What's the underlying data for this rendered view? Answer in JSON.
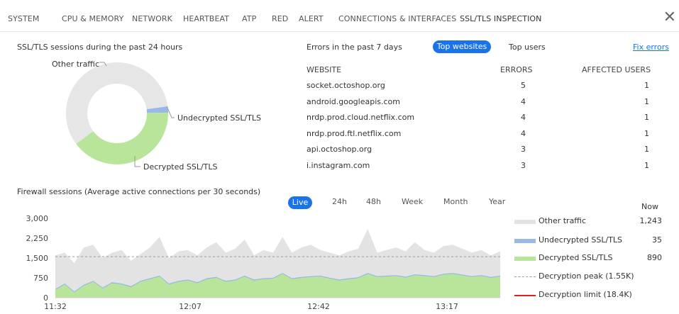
{
  "nav": {
    "tabs": [
      "SYSTEM",
      "CPU & MEMORY",
      "NETWORK",
      "HEARTBEAT",
      "ATP",
      "RED",
      "ALERT",
      "CONNECTIONS & INTERFACES",
      "SSL/TLS INSPECTION"
    ],
    "active_index": 8,
    "close_icon": "close-icon"
  },
  "sessions_donut": {
    "title": "SSL/TLS sessions during the past 24 hours",
    "labels": {
      "other": "Other traffic",
      "undecrypted": "Undecrypted SSL/TLS",
      "decrypted": "Decrypted SSL/TLS"
    },
    "colors": {
      "other": "#e6e6e6",
      "undecrypted": "#9ab8e8",
      "decrypted": "#b9e59a"
    }
  },
  "errors": {
    "title": "Errors in the past 7 days",
    "toggle_active": "Top websites",
    "toggle_inactive": "Top users",
    "fix_link": "Fix errors",
    "columns": [
      "WEBSITE",
      "ERRORS",
      "AFFECTED USERS"
    ],
    "rows": [
      {
        "website": "socket.octoshop.org",
        "errors": "5",
        "users": "1"
      },
      {
        "website": "android.googleapis.com",
        "errors": "4",
        "users": "1"
      },
      {
        "website": "nrdp.prod.cloud.netflix.com",
        "errors": "4",
        "users": "1"
      },
      {
        "website": "nrdp.prod.ftl.netflix.com",
        "errors": "4",
        "users": "1"
      },
      {
        "website": "api.octoshop.org",
        "errors": "3",
        "users": "1"
      },
      {
        "website": "i.instagram.com",
        "errors": "3",
        "users": "1"
      }
    ]
  },
  "firewall": {
    "title": "Firewall sessions (Average active connections per 30 seconds)",
    "ranges": [
      "Live",
      "24h",
      "48h",
      "Week",
      "Month",
      "Year"
    ],
    "active_range": "Live",
    "now_label": "Now",
    "legend": [
      {
        "label": "Other traffic",
        "value": "1,243",
        "color": "#e3e3e3",
        "kind": "bar"
      },
      {
        "label": "Undecrypted SSL/TLS",
        "value": "35",
        "color": "#9ab8e8",
        "kind": "bar"
      },
      {
        "label": "Decrypted SSL/TLS",
        "value": "890",
        "color": "#b9e59a",
        "kind": "bar"
      },
      {
        "label": "Decryption peak (1.55K)",
        "value": "",
        "color": "#999999",
        "kind": "dash"
      },
      {
        "label": "Decryption limit (18.4K)",
        "value": "",
        "color": "#e02020",
        "kind": "line"
      }
    ]
  },
  "chart_data": {
    "type": "area",
    "title": "Firewall sessions (Average active connections per 30 seconds)",
    "xlabel": "",
    "ylabel": "",
    "x_ticks": [
      "11:32",
      "12:07",
      "12:42",
      "13:17"
    ],
    "y_ticks": [
      "0",
      "750",
      "1,500",
      "2,250",
      "3,000"
    ],
    "ylim": [
      0,
      3000
    ],
    "peak_line": 1550,
    "series": [
      {
        "name": "Other traffic",
        "color": "#e3e3e3",
        "values": [
          1600,
          1700,
          1300,
          1900,
          2000,
          1500,
          1700,
          1800,
          1400,
          1650,
          1900,
          2300,
          1500,
          1750,
          1800,
          1600,
          1900,
          2100,
          1700,
          1850,
          2200,
          1600,
          1800,
          1700,
          2300,
          1700,
          1900,
          2000,
          1800,
          1700,
          1600,
          1750,
          1850,
          2600,
          1700,
          1800,
          1900,
          1750,
          2100,
          1800,
          1700,
          1950,
          2000,
          1850,
          1700,
          1800,
          1600,
          1750
        ]
      },
      {
        "name": "Undecrypted SSL/TLS",
        "color": "#9ab8e8",
        "values": [
          35,
          35,
          35,
          35,
          35,
          35,
          35,
          35,
          35,
          35,
          35,
          35,
          35,
          35,
          35,
          35,
          35,
          35,
          35,
          35,
          35,
          35,
          35,
          35,
          35,
          35,
          35,
          35,
          35,
          35,
          35,
          35,
          35,
          35,
          35,
          35,
          35,
          35,
          35,
          35,
          35,
          35,
          35,
          35,
          35,
          35,
          35,
          35
        ]
      },
      {
        "name": "Decrypted SSL/TLS",
        "color": "#b9e59a",
        "values": [
          300,
          500,
          200,
          450,
          600,
          350,
          550,
          500,
          400,
          600,
          700,
          800,
          500,
          600,
          650,
          550,
          700,
          750,
          600,
          650,
          800,
          650,
          700,
          720,
          900,
          700,
          750,
          780,
          800,
          720,
          650,
          700,
          740,
          900,
          780,
          800,
          820,
          760,
          850,
          820,
          780,
          870,
          900,
          840,
          780,
          820,
          750,
          800
        ]
      }
    ],
    "donut": {
      "type": "pie",
      "categories": [
        "Other traffic",
        "Undecrypted SSL/TLS",
        "Decrypted SSL/TLS"
      ],
      "values": [
        58,
        2,
        40
      ]
    }
  }
}
